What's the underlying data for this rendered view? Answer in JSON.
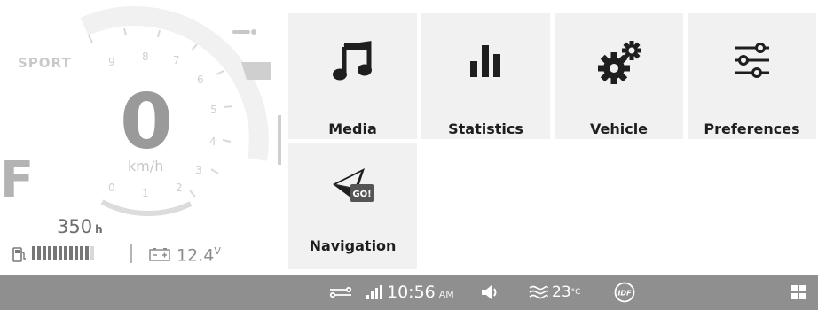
{
  "cluster": {
    "mode": "SPORT",
    "speed": "0",
    "speed_unit": "km/h",
    "gear": "F",
    "range_value": "350",
    "range_unit": "h",
    "voltage_value": "12.4",
    "voltage_unit": "V",
    "fuel_level_fraction": 0.92,
    "rpm_labels": [
      "9",
      "8",
      "7",
      "6",
      "5",
      "4",
      "3",
      "2",
      "1",
      "0"
    ]
  },
  "tiles": {
    "media": {
      "label": "Media",
      "icon": "music-note-icon"
    },
    "statistics": {
      "label": "Statistics",
      "icon": "bar-chart-icon"
    },
    "vehicle": {
      "label": "Vehicle",
      "icon": "gears-icon"
    },
    "preferences": {
      "label": "Preferences",
      "icon": "sliders-icon"
    },
    "navigation": {
      "label": "Navigation",
      "icon": "navigation-go-icon",
      "badge": "GO!"
    }
  },
  "statusbar": {
    "time": "10:56",
    "ampm": "AM",
    "temperature": "23",
    "temperature_unit": "°C",
    "idf_label": "IDF",
    "icons": [
      "connection-icon",
      "signal-icon",
      "volume-icon",
      "temperature-icon",
      "idf-icon",
      "grid-menu-icon"
    ]
  },
  "colors": {
    "tile_bg": "#f1f1f1",
    "statusbar_bg": "#8f8f8f",
    "icon_dark": "#1e1e1e"
  }
}
